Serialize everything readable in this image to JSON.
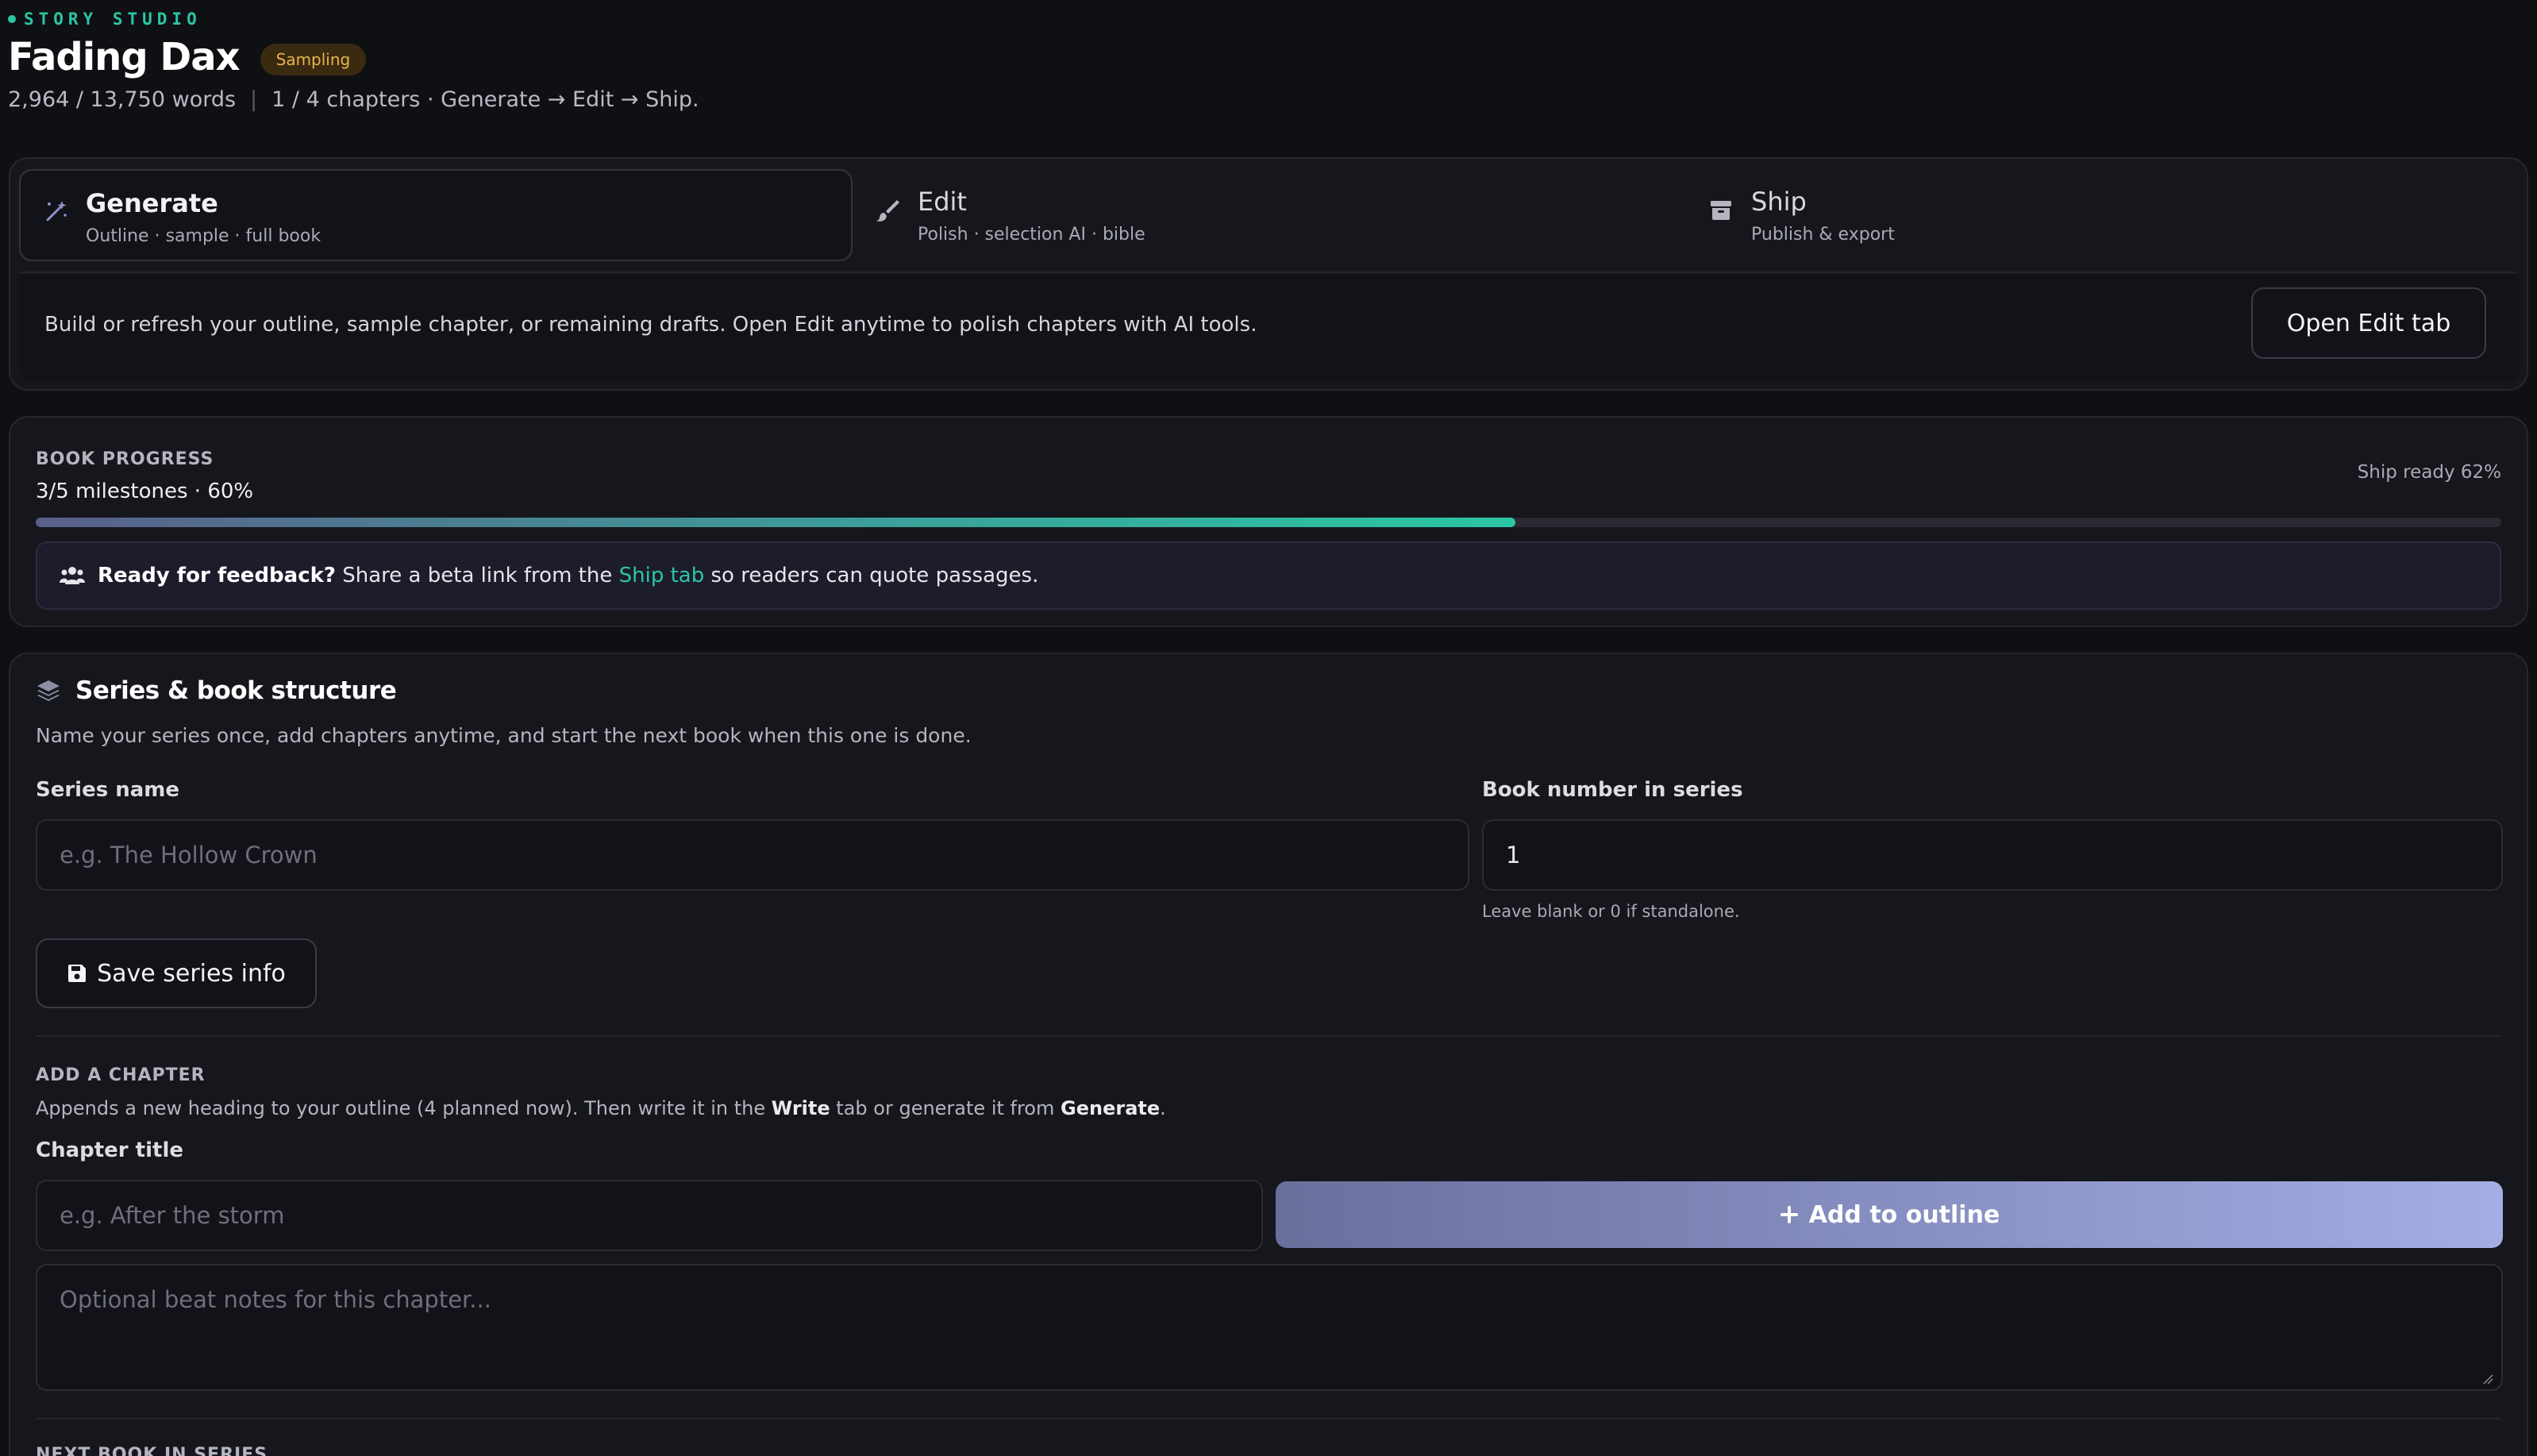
{
  "header": {
    "brand": "STORY STUDIO",
    "title": "Fading Dax",
    "badge": "Sampling",
    "words": "2,964 / 13,750 words",
    "chapters_flow": "1 / 4 chapters · Generate → Edit → Ship."
  },
  "tabs": [
    {
      "title": "Generate",
      "subtitle": "Outline · sample · full book",
      "icon": "magic-wand-icon",
      "active": true
    },
    {
      "title": "Edit",
      "subtitle": "Polish · selection AI · bible",
      "icon": "brush-icon",
      "active": false
    },
    {
      "title": "Ship",
      "subtitle": "Publish & export",
      "icon": "archive-box-icon",
      "active": false
    }
  ],
  "tab_body": {
    "text": "Build or refresh your outline, sample chapter, or remaining drafts. Open Edit anytime to polish chapters with AI tools.",
    "button": "Open Edit tab"
  },
  "progress": {
    "label": "BOOK PROGRESS",
    "summary": "3/5 milestones · 60%",
    "ship_ready": "Ship ready 62%",
    "fill_percent": 60,
    "feedback_bold": "Ready for feedback?",
    "feedback_pre": "Share a beta link from the",
    "feedback_link": "Ship tab",
    "feedback_post": "so readers can quote passages."
  },
  "series": {
    "title": "Series & book structure",
    "description": "Name your series once, add chapters anytime, and start the next book when this one is done.",
    "name_label": "Series name",
    "name_placeholder": "e.g. The Hollow Crown",
    "number_label": "Book number in series",
    "number_value": "1",
    "number_hint": "Leave blank or 0 if standalone.",
    "save_button": "Save series info"
  },
  "add_chapter": {
    "label": "ADD A CHAPTER",
    "desc_pre": "Appends a new heading to your outline (4 planned now). Then write it in the",
    "desc_write": "Write",
    "desc_mid": "tab or generate it from",
    "desc_generate": "Generate",
    "desc_end": ".",
    "title_label": "Chapter title",
    "title_placeholder": "e.g. After the storm",
    "add_button": "Add to outline",
    "notes_placeholder": "Optional beat notes for this chapter..."
  },
  "next_book": {
    "label": "NEXT BOOK IN SERIES"
  },
  "colors": {
    "accent": "#2bc6a4",
    "badge_text": "#e9b44c",
    "background": "#0f1014",
    "card": "#16171c"
  }
}
